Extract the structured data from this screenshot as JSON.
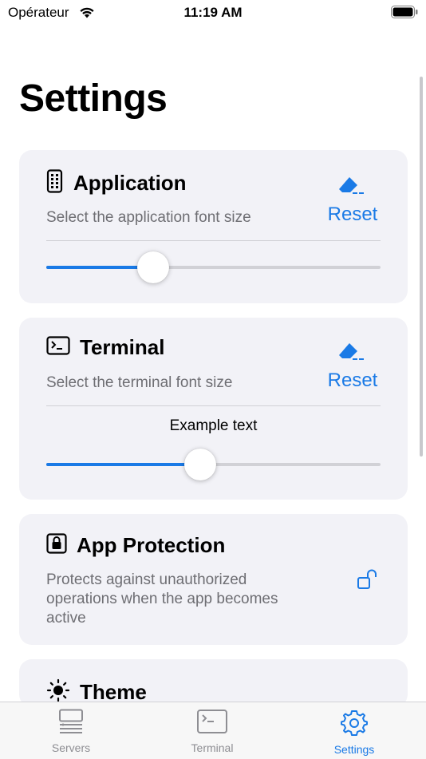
{
  "status_bar": {
    "carrier": "Opérateur",
    "time": "11:19 AM"
  },
  "page": {
    "title": "Settings"
  },
  "application": {
    "title": "Application",
    "subtitle": "Select the application font size",
    "reset_label": "Reset",
    "slider_value": 0.32
  },
  "terminal": {
    "title": "Terminal",
    "subtitle": "Select the terminal font size",
    "reset_label": "Reset",
    "example_text": "Example text",
    "slider_value": 0.46
  },
  "app_protection": {
    "title": "App Protection",
    "description": "Protects against unauthorized operations when the app becomes active"
  },
  "theme": {
    "title": "Theme"
  },
  "tab_bar": {
    "tabs": [
      {
        "label": "Servers",
        "icon": "servers-icon",
        "active": false
      },
      {
        "label": "Terminal",
        "icon": "terminal-icon",
        "active": false
      },
      {
        "label": "Settings",
        "icon": "gear-icon",
        "active": true
      }
    ]
  },
  "colors": {
    "accent": "#1a7ae6",
    "card_bg": "#f2f2f7",
    "secondary_text": "#6e6e73",
    "inactive_tab": "#8e8e93"
  }
}
